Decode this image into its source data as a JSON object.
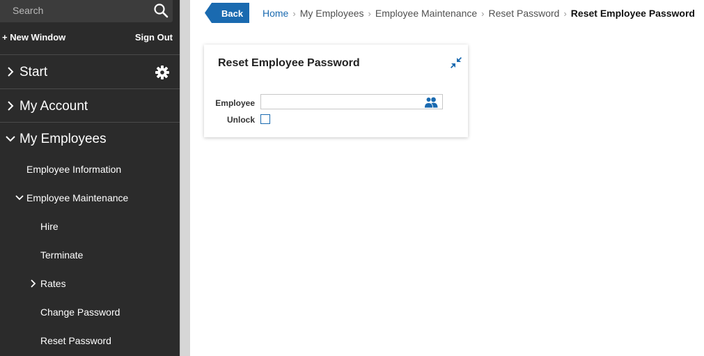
{
  "search": {
    "placeholder": "Search"
  },
  "top_links": {
    "new_window": "+ New Window",
    "sign_out": "Sign Out"
  },
  "nav": {
    "start": "Start",
    "my_account": "My Account",
    "my_employees": "My Employees",
    "employee_information": "Employee Information",
    "employee_maintenance": "Employee Maintenance",
    "hire": "Hire",
    "terminate": "Terminate",
    "rates": "Rates",
    "change_password": "Change Password",
    "reset_password": "Reset Password"
  },
  "header": {
    "back_label": "Back",
    "breadcrumb": [
      "Home",
      "My Employees",
      "Employee Maintenance",
      "Reset Password",
      "Reset Employee Password"
    ]
  },
  "card": {
    "title": "Reset Employee Password",
    "employee_label": "Employee",
    "employee_value": "",
    "unlock_label": "Unlock",
    "unlock_checked": false
  },
  "colors": {
    "accent": "#1a6ab0",
    "sidebar_bg": "#2b2b2b"
  },
  "icons": [
    "search-icon",
    "gear-icon",
    "chevron-right-icon",
    "chevron-down-icon",
    "collapse-icon",
    "people-icon"
  ]
}
